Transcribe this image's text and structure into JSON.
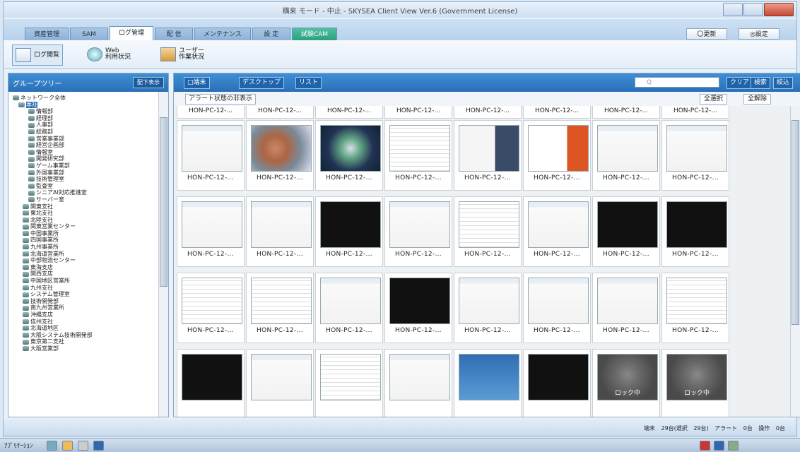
{
  "window": {
    "title": "横来 モード - 中止 - SKYSEA Client View Ver.6 (Government License)"
  },
  "tabs": [
    "資産管理",
    "SAM",
    "ログ管理",
    "配 信",
    "メンテナンス",
    "設 定",
    "試験CAM"
  ],
  "top_buttons": [
    "〇更新",
    "◎設定"
  ],
  "ribbon": [
    {
      "label": "ログ閲覧",
      "icon": "log-icon"
    },
    {
      "label": "Web\n利用状況",
      "icon": "globe-icon"
    },
    {
      "label": "ユーザー\n作業状況",
      "icon": "user-icon"
    }
  ],
  "sidebar": {
    "title": "グループツリー",
    "button": "配下表示",
    "nodes": [
      "ネットワーク全体",
      "本社",
      "情報部",
      "経理部",
      "人事部",
      "総務部",
      "営業事業部",
      "経営企画部",
      "情報室",
      "開発研究部",
      "ゲーム事業部",
      "外国事業部",
      "技術管理室",
      "監査室",
      "シニアAI対応推進室",
      "サーバー室",
      "関東支社",
      "東北支社",
      "北陸支社",
      "関東営業センター",
      "中国事業所",
      "四国事業所",
      "九州事業所",
      "北海道営業所",
      "中部物流センター",
      "東海支店",
      "関西支店",
      "中国地区営業所",
      "九州支社",
      "システム管理室",
      "技術開発部",
      "南九州営業所",
      "沖縄支店",
      "信州支社",
      "北海道地区",
      "大阪システム技術開発部",
      "東京第二支社",
      "大阪営業部"
    ]
  },
  "main": {
    "toolbar": {
      "dropdown": "□端末",
      "view_desktop": "デスクトップ",
      "view_list": "リスト",
      "search_placeholder": "Q",
      "clear": "クリア",
      "search": "検索",
      "refine": "絞込"
    },
    "alert_button": "アラート状態の非表示",
    "select_all": "全選択",
    "deselect_all": "全解除",
    "thumb_label": "HON-PC-12-...",
    "lock_label": "ロック中",
    "rows": [
      [
        "ss",
        "ssmap",
        "ssblue",
        "ssgrid",
        "ss2",
        "ssred",
        "ss",
        "ss"
      ],
      [
        "ss",
        "ss",
        "dark",
        "ss",
        "ssgrid",
        "ss",
        "dark",
        "dark"
      ],
      [
        "ssgrid",
        "ssgrid",
        "ss",
        "dark",
        "ss",
        "ss",
        "ss",
        "ssgrid"
      ],
      [
        "dark",
        "ss",
        "ssgrid",
        "ss",
        "ssdesk",
        "dark",
        "lock",
        "lock"
      ]
    ]
  },
  "status": {
    "text": "端末 29台(選択 29台)  アラート 0台  操作 0台"
  },
  "taskbar": {
    "start": "ｱﾌﾟﾘｹｰｼｮﾝ"
  }
}
